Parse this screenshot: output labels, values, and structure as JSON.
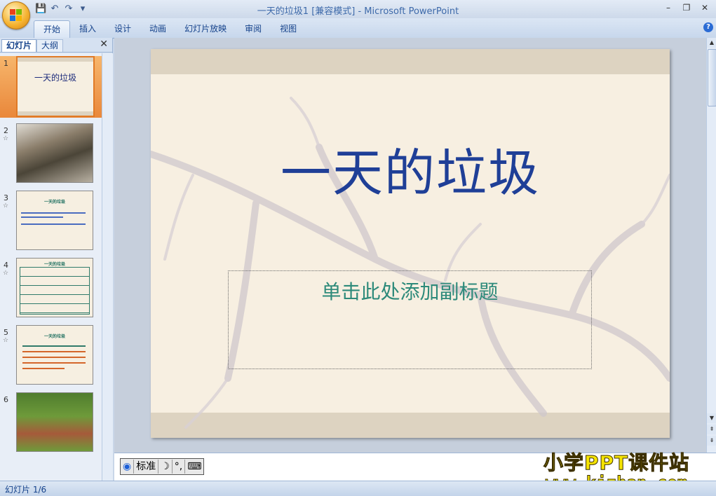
{
  "window": {
    "title": "一天的垃圾1 [兼容模式] - Microsoft PowerPoint",
    "controls": [
      "–",
      "❐",
      "✕"
    ]
  },
  "qat": {
    "save_icon": "save-icon",
    "undo_icon": "undo-icon",
    "redo_icon": "redo-icon"
  },
  "ribbon": {
    "tabs": [
      {
        "label": "开始",
        "active": true
      },
      {
        "label": "插入"
      },
      {
        "label": "设计"
      },
      {
        "label": "动画"
      },
      {
        "label": "幻灯片放映"
      },
      {
        "label": "审阅"
      },
      {
        "label": "视图"
      }
    ],
    "help": "?"
  },
  "left_pane": {
    "tab_slides": "幻灯片",
    "tab_outline": "大纲",
    "close": "✕",
    "thumbnails": [
      {
        "num": "1",
        "title": "一天的垃圾",
        "selected": true
      },
      {
        "num": "2",
        "star": "☆"
      },
      {
        "num": "3",
        "star": "☆",
        "heading": "一天的垃圾"
      },
      {
        "num": "4",
        "star": "☆",
        "heading": "一天的垃圾"
      },
      {
        "num": "5",
        "star": "☆",
        "heading": "一天的垃圾"
      },
      {
        "num": "6"
      }
    ]
  },
  "slide": {
    "title": "一天的垃圾",
    "subtitle": "单击此处添加副标题"
  },
  "notes": {
    "ime_label": "标准",
    "watermark_line1": "小学PPT课件站",
    "watermark_line2": "www.kjzhan.com"
  },
  "status": {
    "slide_counter": "幻灯片 1/6"
  },
  "colors": {
    "title": "#1f3f97",
    "subtitle": "#2d8a7a",
    "selection": "#e9873a"
  }
}
